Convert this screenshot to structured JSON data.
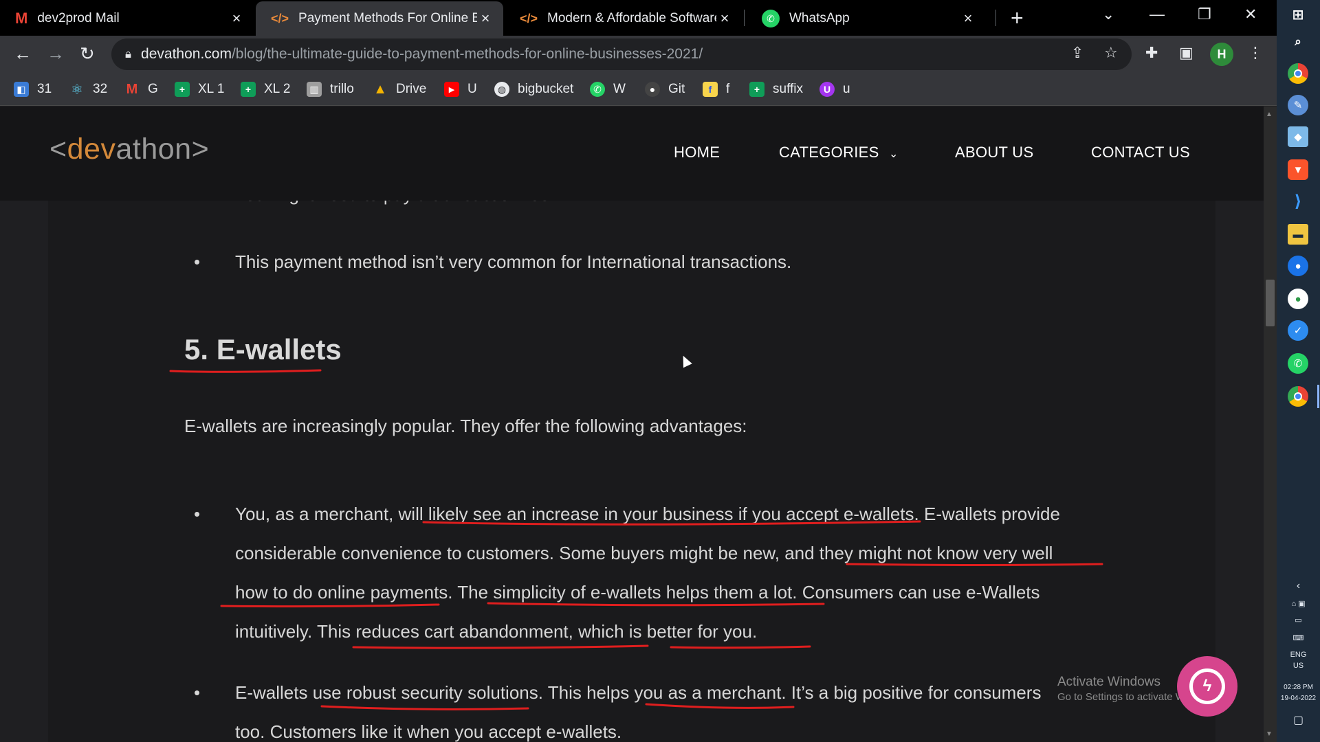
{
  "browser": {
    "tabs": [
      {
        "title": "dev2prod Mail",
        "icon": "gmail-icon",
        "active": false
      },
      {
        "title": "Payment Methods For Online Bu",
        "icon": "code-icon",
        "active": true
      },
      {
        "title": "Modern & Affordable Software D",
        "icon": "code-icon",
        "active": false
      },
      {
        "title": "WhatsApp",
        "icon": "whatsapp-icon",
        "active": false
      }
    ],
    "url_host": "devathon.com",
    "url_path": "/blog/the-ultimate-guide-to-payment-methods-for-online-businesses-2021/",
    "profile_initial": "H",
    "bookmarks": [
      {
        "label": "31",
        "icon": "bookmark-31-icon",
        "color": "#3a7bd5"
      },
      {
        "label": "32",
        "icon": "react-icon",
        "color": "#2b6e8f"
      },
      {
        "label": "G",
        "icon": "gmail-icon",
        "color": "#ea4335"
      },
      {
        "label": "XL 1",
        "icon": "sheets-icon",
        "color": "#0f9d58"
      },
      {
        "label": "XL 2",
        "icon": "sheets-icon",
        "color": "#0f9d58"
      },
      {
        "label": "trillo",
        "icon": "trello-icon",
        "color": "#a0a0a0"
      },
      {
        "label": "Drive",
        "icon": "drive-icon",
        "color": "#f4b400"
      },
      {
        "label": "U",
        "icon": "youtube-icon",
        "color": "#ff0000"
      },
      {
        "label": "bigbucket",
        "icon": "globe-icon",
        "color": "#e8eaed"
      },
      {
        "label": "W",
        "icon": "whatsapp-icon",
        "color": "#25d366"
      },
      {
        "label": "Git",
        "icon": "github-icon",
        "color": "#444"
      },
      {
        "label": "f",
        "icon": "flipkart-icon",
        "color": "#f7d44c"
      },
      {
        "label": "suffix",
        "icon": "sheets-icon",
        "color": "#0f9d58"
      },
      {
        "label": "u",
        "icon": "udemy-icon",
        "color": "#a435f0"
      }
    ]
  },
  "site": {
    "logo": {
      "open": "<",
      "dev": "dev",
      "athon": "athon",
      "close": ">"
    },
    "nav": [
      "HOME",
      "CATEGORIES",
      "ABOUT US",
      "CONTACT US"
    ],
    "partial_bullet": "You might need to pay a transaction fee.",
    "bullet_prev": "This payment method isn’t very common for International transactions.",
    "section_title": "5. E-wallets",
    "intro": "E-wallets are increasingly popular. They offer the following advantages:",
    "bullets": [
      {
        "lines": [
          "You, as a merchant, will likely see an increase in your business if you accept e-wallets. E-wallets provide",
          "considerable convenience to customers. Some buyers might be new, and they might not know very well",
          "how to do online payments. The simplicity of e-wallets helps them a lot. Consumers can use e-Wallets",
          "intuitively. This reduces cart abandonment, which is better for you."
        ]
      },
      {
        "lines": [
          "E-wallets use robust security solutions. This helps you as a merchant. It’s a big positive for consumers",
          "too. Customers like it when you accept e-wallets."
        ]
      }
    ]
  },
  "watermark": {
    "line1": "Activate Windows",
    "line2": "Go to Settings to activate Windows."
  },
  "taskbar": {
    "lang": "ENG",
    "region": "US",
    "time": "02:28 PM",
    "date": "19-04-2022"
  },
  "colors": {
    "accent_logo": "#d4893a",
    "annotation_red": "#e01e1e",
    "chat_fab": "#d6458d"
  }
}
